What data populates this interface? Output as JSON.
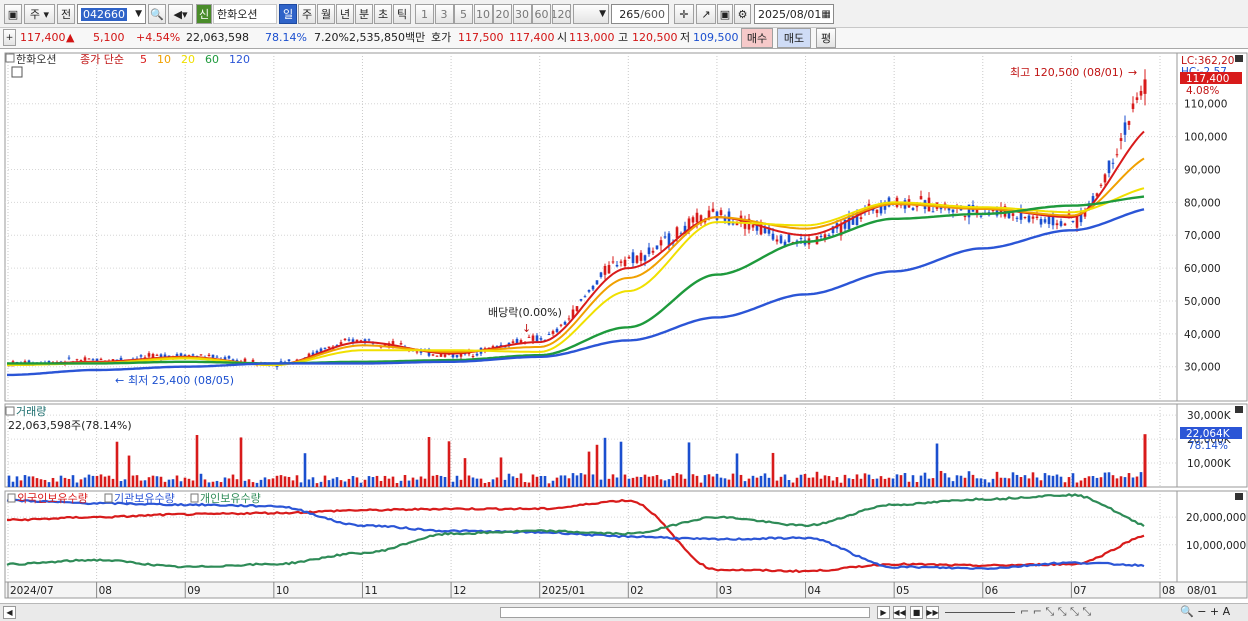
{
  "toolbar": {
    "menu_label": "주",
    "prev_label": "전",
    "code": "042660",
    "badge": "신",
    "name": "한화오션",
    "periods": [
      "일",
      "주",
      "월",
      "년",
      "분",
      "초",
      "틱"
    ],
    "active_period": "일",
    "intervals": [
      "1",
      "3",
      "5",
      "10",
      "20",
      "30",
      "60",
      "120"
    ],
    "count": "265",
    "count_total": "/600",
    "date": "2025/08/01"
  },
  "quote": {
    "price": "117,400",
    "change": "5,100",
    "change_pct": "+4.54%",
    "volume": "22,063,598",
    "vol_ratio": "78.14%",
    "turnover": "7.20%",
    "amount": "2,535,850백만",
    "bid_label": "호가",
    "bid1": "117,500",
    "bid2": "117,400",
    "open_label": "시",
    "open": "113,000",
    "high_label": "고",
    "high": "120,500",
    "low_label": "저",
    "low": "109,500",
    "buy_label": "매수",
    "sell_label": "매도",
    "eval_label": "평"
  },
  "price_panel": {
    "legend_name": "한화오션",
    "legend_ma": "종가 단순",
    "ma_periods": [
      "5",
      "10",
      "20",
      "60",
      "120"
    ],
    "ma_colors": [
      "#d81b1b",
      "#f0a000",
      "#f0e000",
      "#1e9a3c",
      "#2b55d6"
    ],
    "max_label": "최고 120,500 (08/01)",
    "min_label": "최저 25,400 (08/05)",
    "dividend_label": "배당락(0.00%)",
    "lc_label": "LC:362,20",
    "hc_label": "HC:-2,57",
    "current_tag": "117,400",
    "current_pct": "4.08%"
  },
  "volume_panel": {
    "title": "거래량",
    "value_label": "22,063,598주(78.14%)",
    "current_tag": "22,064K",
    "current_pct": "78.14%"
  },
  "holdings_panel": {
    "series_labels": [
      "외국인보유수량",
      "기관보유수량",
      "개인보유수량"
    ],
    "colors": [
      "#d81b1b",
      "#2b55d6",
      "#2e8b57"
    ]
  },
  "x_axis_labels": [
    "2024/07",
    "08",
    "09",
    "10",
    "11",
    "12",
    "2025/01",
    "02",
    "03",
    "04",
    "05",
    "06",
    "07",
    "08",
    "08/01"
  ],
  "chart_data": [
    {
      "type": "line",
      "title": "한화오션",
      "y_ticks": [
        30000,
        40000,
        50000,
        60000,
        70000,
        80000,
        90000,
        100000,
        110000
      ],
      "ylim": [
        22000,
        123000
      ],
      "months": [
        "2024/07",
        "08",
        "09",
        "10",
        "11",
        "12",
        "2025/01",
        "02",
        "03",
        "04",
        "05",
        "06",
        "07",
        "08"
      ],
      "close_monthly": [
        31000,
        32000,
        33500,
        31000,
        38000,
        33500,
        38500,
        63000,
        76000,
        68000,
        80000,
        77500,
        74000,
        117400
      ],
      "series": [
        {
          "name": "5",
          "values": [
            30500,
            31500,
            33000,
            30500,
            37500,
            34000,
            37500,
            60000,
            75500,
            70000,
            79500,
            78000,
            75500,
            104000
          ]
        },
        {
          "name": "10",
          "values": [
            30500,
            31200,
            32800,
            30500,
            36500,
            34500,
            36000,
            57000,
            75500,
            72000,
            79500,
            78000,
            76000,
            95000
          ]
        },
        {
          "name": "20",
          "values": [
            30500,
            31000,
            32500,
            30500,
            35000,
            35000,
            34500,
            53000,
            74000,
            73000,
            80000,
            78500,
            77000,
            85000
          ]
        },
        {
          "name": "60",
          "values": [
            31000,
            31000,
            31500,
            31000,
            31500,
            32000,
            33500,
            42000,
            58000,
            68000,
            75000,
            76500,
            79000,
            82000
          ]
        },
        {
          "name": "120",
          "values": [
            27500,
            29000,
            30000,
            31000,
            31000,
            31500,
            33000,
            38000,
            45000,
            52000,
            59000,
            66000,
            71500,
            78500
          ]
        }
      ]
    },
    {
      "type": "bar",
      "title": "거래량",
      "y_ticks": [
        10000,
        20000,
        30000
      ],
      "ylim": [
        0,
        33000
      ],
      "unit": "K",
      "last_value": 22064
    },
    {
      "type": "line",
      "title": "보유수량",
      "y_ticks": [
        10000000,
        20000000
      ],
      "y_tick_labels": [
        "10,000,000",
        "20,000,000"
      ],
      "ylim": [
        -2000000,
        28000000
      ],
      "series": [
        {
          "name": "외국인보유수량",
          "values": [
            19000000,
            20000000,
            21000000,
            21500000,
            22500000,
            23000000,
            23000000,
            26000000,
            1000000,
            500000,
            3000000,
            2500000,
            3000000,
            14500000
          ]
        },
        {
          "name": "기관보유수량",
          "values": [
            26000000,
            25000000,
            24500000,
            24000000,
            17000000,
            15000000,
            14500000,
            13000000,
            12000000,
            12500000,
            2000000,
            1500000,
            3500000,
            2500000
          ]
        },
        {
          "name": "개인보유수량",
          "values": [
            3000000,
            4500000,
            2000000,
            3000000,
            7000000,
            14000000,
            15000000,
            14000000,
            20000000,
            17000000,
            24500000,
            26500000,
            28000000,
            16000000
          ]
        }
      ]
    }
  ],
  "scrollbar": {
    "nav_icons": [
      "play-icon",
      "rewind-icon",
      "stop-icon",
      "fast-forward-icon"
    ]
  }
}
